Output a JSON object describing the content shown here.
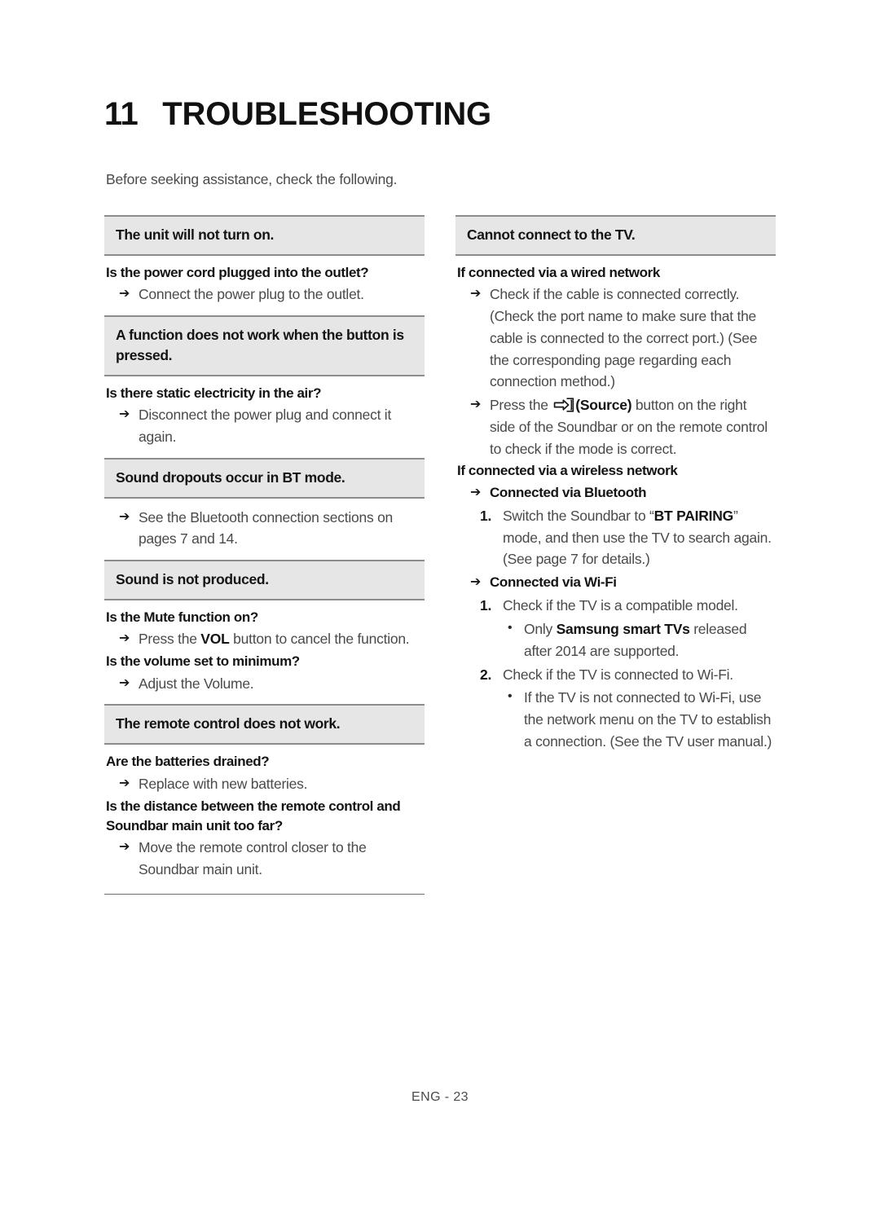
{
  "page": {
    "chapter_number": "11",
    "chapter_title": "TROUBLESHOOTING",
    "intro": "Before seeking assistance, check the following.",
    "footer": "ENG - 23"
  },
  "icons": {
    "arrow": "➔",
    "bullet": "•",
    "source": "source-icon"
  },
  "left_column": {
    "sections": [
      {
        "header": "The unit will not turn on.",
        "q1": "Is the power cord plugged into the outlet?",
        "a1": "Connect the power plug to the outlet."
      },
      {
        "header": "A function does not work when the button is pressed.",
        "q1": "Is there static electricity in the air?",
        "a1": "Disconnect the power plug and connect it again."
      },
      {
        "header": "Sound dropouts occur in BT mode.",
        "a1": "See the Bluetooth connection sections on pages 7 and 14."
      },
      {
        "header": "Sound is not produced.",
        "q1": "Is the Mute function on?",
        "a1_pre": "Press the ",
        "a1_bold": "VOL",
        "a1_post": " button to cancel the function.",
        "q2": "Is the volume set to minimum?",
        "a2": "Adjust the Volume."
      },
      {
        "header": "The remote control does not work.",
        "q1": "Are the batteries drained?",
        "a1": "Replace with new batteries.",
        "q2": "Is the distance between the remote control and Soundbar main unit too far?",
        "a2": "Move the remote control closer to the Soundbar main unit."
      }
    ]
  },
  "right_column": {
    "header": "Cannot connect to the TV.",
    "wired": {
      "title": "If connected via a wired network",
      "a1": "Check if the cable is connected correctly. (Check the port name to make sure that the cable is connected to the correct port.) (See the corresponding page regarding each connection method.)",
      "a2_pre": "Press the ",
      "a2_bold": "(Source)",
      "a2_post": " button on the right side of the Soundbar or on the remote control to check if the mode is correct."
    },
    "wireless": {
      "title": "If connected via a wireless network",
      "bluetooth_label": "Connected via Bluetooth",
      "bluetooth_steps": [
        {
          "num": "1.",
          "pre": "Switch the Soundbar to “",
          "bold": "BT PAIRING",
          "post": "” mode, and then use the TV to search again. (See page 7 for details.)"
        }
      ],
      "wifi_label": "Connected via Wi-Fi",
      "wifi_steps": [
        {
          "num": "1.",
          "text": "Check if the TV is a compatible model.",
          "bullet_pre": "Only ",
          "bullet_bold": "Samsung smart TVs",
          "bullet_post": " released after 2014 are supported."
        },
        {
          "num": "2.",
          "text": "Check if the TV is connected to Wi-Fi.",
          "bullet": "If the TV is not connected to Wi-Fi, use the network menu on the TV to establish a connection. (See the TV user manual.)"
        }
      ]
    }
  }
}
